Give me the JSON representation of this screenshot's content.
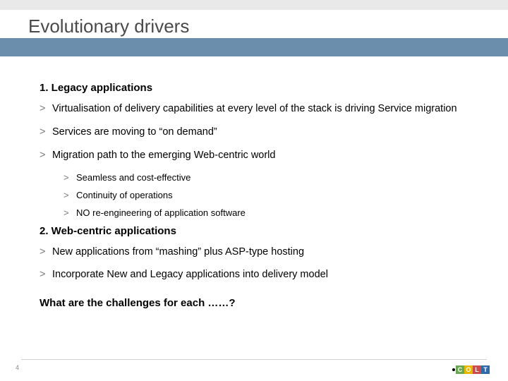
{
  "title": "Evolutionary drivers",
  "sections": [
    {
      "heading": "1. Legacy applications",
      "bullets": [
        {
          "text": "Virtualisation of delivery capabilities at every level of the stack is driving Service migration",
          "sub": []
        },
        {
          "text": "Services are moving to  “on demand”",
          "sub": []
        },
        {
          "text": "Migration path to the emerging Web-centric world",
          "sub": [
            "Seamless and cost-effective",
            "Continuity of operations",
            "NO re-engineering of application software"
          ]
        }
      ]
    },
    {
      "heading": "2. Web-centric applications",
      "bullets": [
        {
          "text": "New applications from “mashing” plus ASP-type hosting",
          "sub": []
        },
        {
          "text": "Incorporate New and Legacy applications into delivery model",
          "sub": []
        }
      ]
    }
  ],
  "closing": "What are the challenges for each ……?",
  "page_number": "4",
  "logo": {
    "letters": [
      "C",
      "O",
      "L",
      "T"
    ],
    "colors": [
      "#6aa84f",
      "#e6b800",
      "#c94b4b",
      "#2e6aa8"
    ]
  }
}
